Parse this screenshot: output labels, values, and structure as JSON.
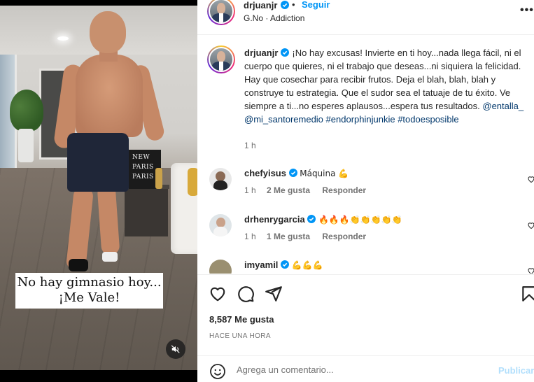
{
  "video": {
    "overlay_line1": "No hay gimnasio hoy...",
    "overlay_line2": "¡Me Vale!",
    "muted_icon": "speaker-muted-icon",
    "books_text": [
      "NEW",
      "PARIS",
      "PARIS"
    ]
  },
  "header": {
    "username": "drjuanjr",
    "separator": "•",
    "follow_label": "Seguir",
    "audio": "G.No · Addiction",
    "more_label": "•••"
  },
  "caption": {
    "username": "drjuanjr",
    "text": "¡No hay excusas! Invierte en ti hoy...nada llega fácil, ni el cuerpo que quieres, ni el trabajo que deseas...ni siquiera la felicidad. Hay que cosechar para recibir frutos. Deja el blah, blah, blah y construye tu estrategia. Que el sudor sea el tatuaje de tu éxito. Ve siempre a ti...no esperes aplausos...espera tus resultados.",
    "tags": [
      "@entalla_",
      "@mi_santoremedio",
      "#endorphinjunkie",
      "#todoesposible"
    ],
    "time": "1 h"
  },
  "comments": [
    {
      "username": "chefyisus",
      "text": "Máquina 💪",
      "time": "1 h",
      "likes": "2 Me gusta",
      "reply": "Responder"
    },
    {
      "username": "drhenrygarcia",
      "text": "🔥🔥🔥👏👏👏👏👏",
      "time": "1 h",
      "likes": "1 Me gusta",
      "reply": "Responder"
    },
    {
      "username": "imyamil",
      "text": "💪💪💪",
      "time": "",
      "likes": "",
      "reply": ""
    }
  ],
  "stats": {
    "likes": "8,587 Me gusta",
    "posted": "HACE UNA HORA"
  },
  "composer": {
    "placeholder": "Agrega un comentario...",
    "publish_label": "Publicar"
  },
  "colors": {
    "link_blue": "#0095f6",
    "tag_blue": "#00376b",
    "muted_text": "#737373",
    "publish_disabled": "#b2dffc"
  }
}
